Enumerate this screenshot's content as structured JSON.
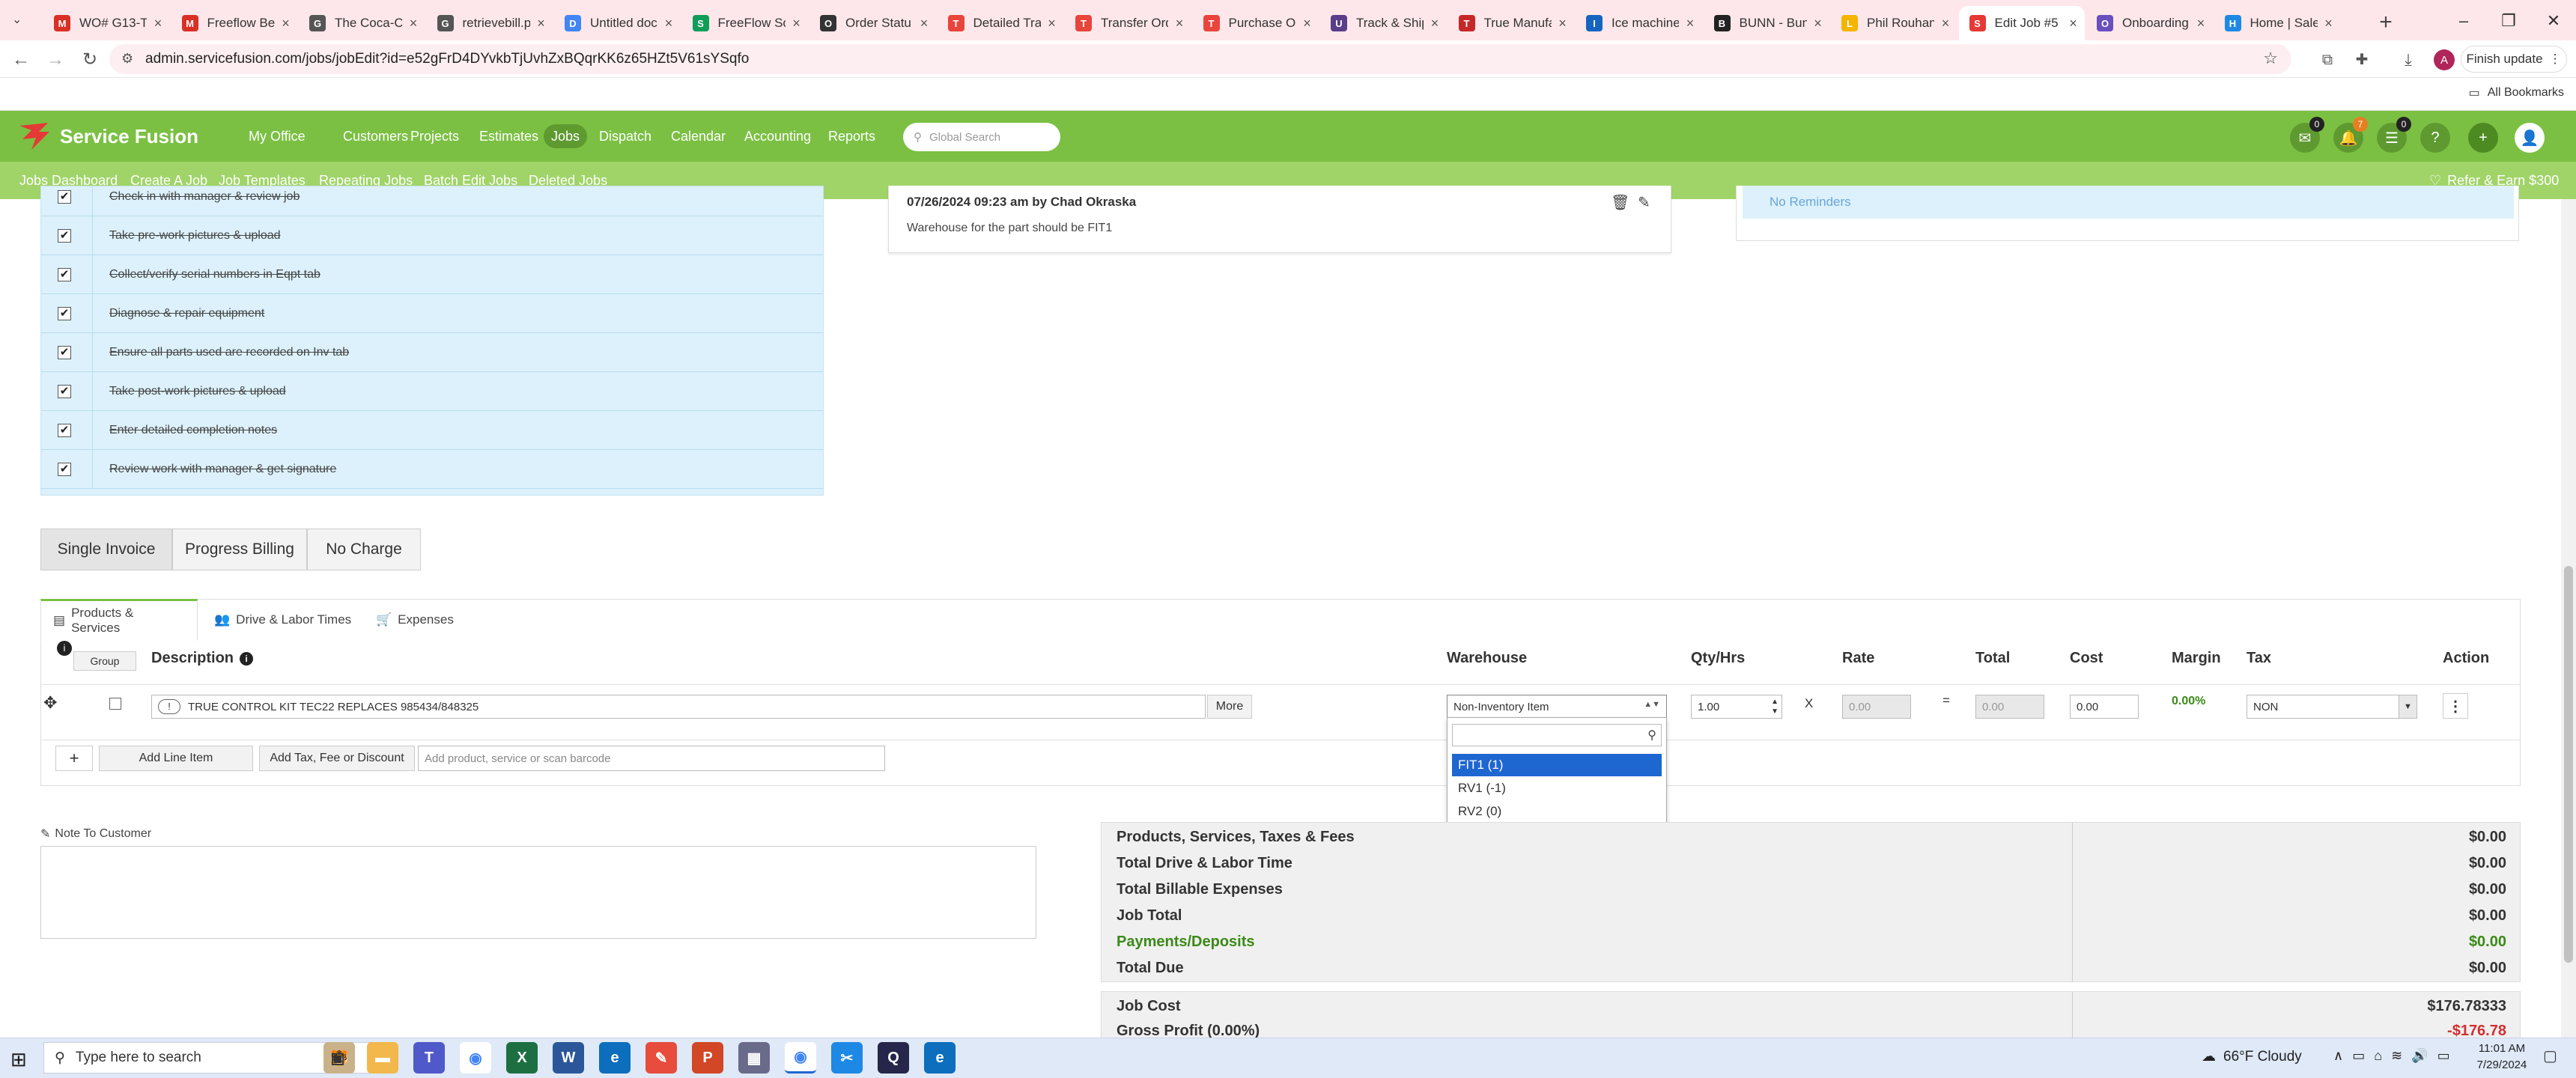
{
  "browser": {
    "tabs": [
      {
        "title": "WO# G13-T",
        "fav": "M",
        "color": "#d93025"
      },
      {
        "title": "Freeflow Be",
        "fav": "M",
        "color": "#d93025"
      },
      {
        "title": "The Coca-Co",
        "fav": "G",
        "color": "#555555"
      },
      {
        "title": "retrievebill.p",
        "fav": "G",
        "color": "#555555"
      },
      {
        "title": "Untitled doc",
        "fav": "D",
        "color": "#4285f4"
      },
      {
        "title": "FreeFlow Sch",
        "fav": "S",
        "color": "#0f9d58"
      },
      {
        "title": "Order Statu",
        "fav": "O",
        "color": "#333333"
      },
      {
        "title": "Detailed Tra",
        "fav": "T",
        "color": "#e8453c"
      },
      {
        "title": "Transfer Ord",
        "fav": "T",
        "color": "#e8453c"
      },
      {
        "title": "Purchase Or",
        "fav": "T",
        "color": "#e8453c"
      },
      {
        "title": "Track & Ship",
        "fav": "U",
        "color": "#5a3e8a"
      },
      {
        "title": "True Manufa",
        "fav": "T",
        "color": "#c62828"
      },
      {
        "title": "Ice machine",
        "fav": "I",
        "color": "#1565c0"
      },
      {
        "title": "BUNN - Bun",
        "fav": "B",
        "color": "#222222"
      },
      {
        "title": "Phil Rouhan",
        "fav": "L",
        "color": "#f4b400"
      },
      {
        "title": "Edit Job #5",
        "fav": "S",
        "color": "#e53935",
        "active": true
      },
      {
        "title": "Onboarding",
        "fav": "O",
        "color": "#6a4fbf"
      },
      {
        "title": "Home | Sale",
        "fav": "H",
        "color": "#1e88e5"
      }
    ],
    "url": "admin.servicefusion.com/jobs/jobEdit?id=e52gFrD4DYvkbTjUvhZxBQqrKK6z65HZt5V61sYSqfo",
    "finish_update": "Finish update",
    "profile_initial": "A",
    "all_bookmarks": "All Bookmarks"
  },
  "app": {
    "brand": "Service Fusion",
    "menu": [
      "My Office",
      "Customers",
      "Projects",
      "Estimates",
      "Jobs",
      "Dispatch",
      "Calendar",
      "Accounting",
      "Reports"
    ],
    "active_menu": "Jobs",
    "search_placeholder": "Global Search",
    "badges": {
      "chat": "0",
      "bell": "7",
      "list": "0"
    },
    "submenu": [
      "Jobs Dashboard",
      "Create A Job",
      "Job Templates",
      "Repeating Jobs",
      "Batch Edit Jobs",
      "Deleted Jobs"
    ],
    "refer": "Refer & Earn $300"
  },
  "checklist": [
    "Check in with manager & review job",
    "Take pre-work pictures & upload",
    "Collect/verify serial numbers in Eqpt tab",
    "Diagnose & repair equipment",
    "Ensure all parts used are recorded on Inv tab",
    "Take post-work pictures & upload",
    "Enter detailed completion notes",
    "Review work with manager & get signature"
  ],
  "note": {
    "header": "07/26/2024 09:23 am by Chad Okraska",
    "body": "Warehouse for the part should be FIT1"
  },
  "reminders": "No Reminders",
  "billing": [
    "Single Invoice",
    "Progress Billing",
    "No Charge"
  ],
  "product_tabs": [
    "Products & Services",
    "Drive & Labor Times",
    "Expenses"
  ],
  "columns": {
    "group": "Group",
    "description": "Description",
    "warehouse": "Warehouse",
    "qty": "Qty/Hrs",
    "rate": "Rate",
    "total": "Total",
    "cost": "Cost",
    "margin": "Margin",
    "tax": "Tax",
    "action": "Action"
  },
  "line_item": {
    "description": "TRUE CONTROL KIT TEC22 REPLACES 985434/848325",
    "more": "More",
    "warehouse": "Non-Inventory Item",
    "qty": "1.00",
    "x": "X",
    "rate": "0.00",
    "eq": "=",
    "total": "0.00",
    "cost": "0.00",
    "margin": "0.00%",
    "tax": "NON"
  },
  "warehouse_options": [
    "FIT1 (1)",
    "RV1 (-1)",
    "RV2 (0)",
    "Non-Inventory Item"
  ],
  "warehouse_selected_index": 0,
  "actions": {
    "add_line": "Add Line Item",
    "add_tax": "Add Tax, Fee or Discount",
    "add_placeholder": "Add product, service or scan barcode"
  },
  "note_to_customer": "Note To Customer",
  "totals": [
    {
      "label": "Products, Services, Taxes & Fees",
      "value": "$0.00",
      "color": "#333333"
    },
    {
      "label": "Total Drive & Labor Time",
      "value": "$0.00",
      "color": "#333333"
    },
    {
      "label": "Total Billable Expenses",
      "value": "$0.00",
      "color": "#333333"
    },
    {
      "label": "Job Total",
      "value": "$0.00",
      "color": "#333333"
    },
    {
      "label": "Payments/Deposits",
      "value": "$0.00",
      "color": "#3a8a17"
    },
    {
      "label": "Total Due",
      "value": "$0.00",
      "color": "#333333"
    }
  ],
  "costs": [
    {
      "label": "Job Cost",
      "value": "$176.78333",
      "color": "#333333"
    },
    {
      "label": "Gross Profit (0.00%)",
      "value": "-$176.78",
      "color": "#d32f2f"
    }
  ],
  "taskbar": {
    "search_placeholder": "Type here to search",
    "weather": "66°F  Cloudy",
    "time": "11:01 AM",
    "date": "7/29/2024"
  }
}
